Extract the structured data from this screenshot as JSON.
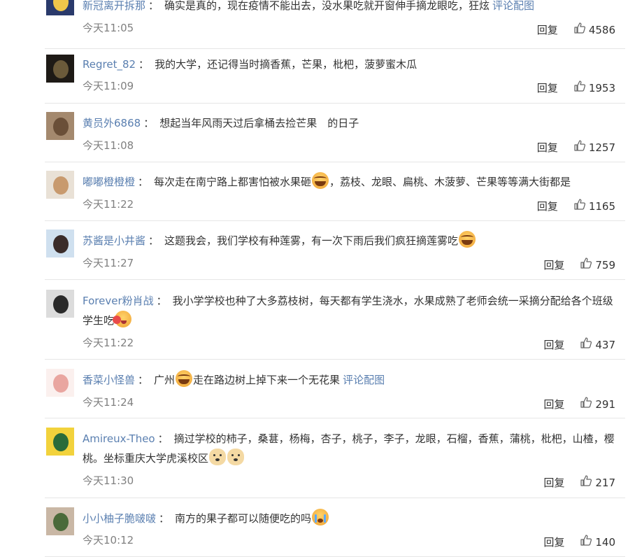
{
  "reply_label": "回复",
  "comments": [
    {
      "user": "新冠离开拆那",
      "segments": [
        {
          "type": "text",
          "text": "确实是真的，现在疫情不能出去，没水果吃就开窗伸手摘龙眼吃，狂炫"
        }
      ],
      "link": "评论配图",
      "time": "今天11:05",
      "likes": "4586",
      "avatar_colors": [
        "#2a3a6b",
        "#f0c64a"
      ]
    },
    {
      "user": "Regret_82",
      "segments": [
        {
          "type": "text",
          "text": "我的大学，还记得当时摘香蕉，芒果，枇杷，菠萝蜜木瓜"
        }
      ],
      "link": "",
      "time": "今天11:09",
      "likes": "1953",
      "avatar_colors": [
        "#1e1a16",
        "#6b5a3a"
      ]
    },
    {
      "user": "黄员外6868",
      "segments": [
        {
          "type": "text",
          "text": "想起当年风雨天过后拿桶去捡芒果　的日子"
        }
      ],
      "link": "",
      "time": "今天11:08",
      "likes": "1257",
      "avatar_colors": [
        "#a4896e",
        "#6a4f38"
      ]
    },
    {
      "user": "嘟嘟橙橙橙",
      "segments": [
        {
          "type": "text",
          "text": "每次走在南宁路上都害怕被水果砸"
        },
        {
          "type": "emoji",
          "icon": "laugh-cry-emoji"
        },
        {
          "type": "text",
          "text": "，荔枝、龙眼、扁桃、木菠萝、芒果等等满大街都是"
        }
      ],
      "link": "",
      "time": "今天11:22",
      "likes": "1165",
      "avatar_colors": [
        "#e9e1d6",
        "#c89a6e"
      ]
    },
    {
      "user": "苏酱是小井酱",
      "segments": [
        {
          "type": "text",
          "text": "这题我会，我们学校有种莲雾，有一次下雨后我们疯狂摘莲雾吃"
        },
        {
          "type": "emoji",
          "icon": "laugh-cry-emoji"
        }
      ],
      "link": "",
      "time": "今天11:27",
      "likes": "759",
      "avatar_colors": [
        "#cfe0ef",
        "#3a2c2a"
      ]
    },
    {
      "user": "Forever粉肖战",
      "segments": [
        {
          "type": "text",
          "text": "我小学学校也种了大多荔枝树，每天都有学生浇水，水果成熟了老师会统一采摘分配给各个班级学生吃"
        },
        {
          "type": "emoji",
          "icon": "drool-emoji"
        }
      ],
      "link": "",
      "time": "今天11:22",
      "likes": "437",
      "avatar_colors": [
        "#dcdcdc",
        "#2a2a2a"
      ]
    },
    {
      "user": "香菜小怪兽",
      "segments": [
        {
          "type": "text",
          "text": "广州"
        },
        {
          "type": "emoji",
          "icon": "laugh-cry-emoji"
        },
        {
          "type": "text",
          "text": "走在路边树上掉下来一个无花果"
        }
      ],
      "link": "评论配图",
      "time": "今天11:24",
      "likes": "291",
      "avatar_colors": [
        "#fbf0ee",
        "#e9a6a0"
      ]
    },
    {
      "user": "Amireux-Theo",
      "segments": [
        {
          "type": "text",
          "text": "摘过学校的柿子，桑葚，杨梅，杏子，桃子，李子，龙眼，石榴，香蕉，蒲桃，枇杷，山楂，樱桃。坐标重庆大学虎溪校区"
        },
        {
          "type": "emoji",
          "icon": "doge-emoji"
        },
        {
          "type": "emoji",
          "icon": "doge-emoji"
        }
      ],
      "link": "",
      "time": "今天11:30",
      "likes": "217",
      "avatar_colors": [
        "#f2d23c",
        "#2a6b3a"
      ]
    },
    {
      "user": "小小柚子脆啵啵",
      "segments": [
        {
          "type": "text",
          "text": "南方的果子都可以随便吃的吗"
        },
        {
          "type": "emoji",
          "icon": "crying-emoji"
        }
      ],
      "link": "",
      "time": "今天10:12",
      "likes": "140",
      "avatar_colors": [
        "#c9b7a5",
        "#4a6a3a"
      ]
    }
  ]
}
